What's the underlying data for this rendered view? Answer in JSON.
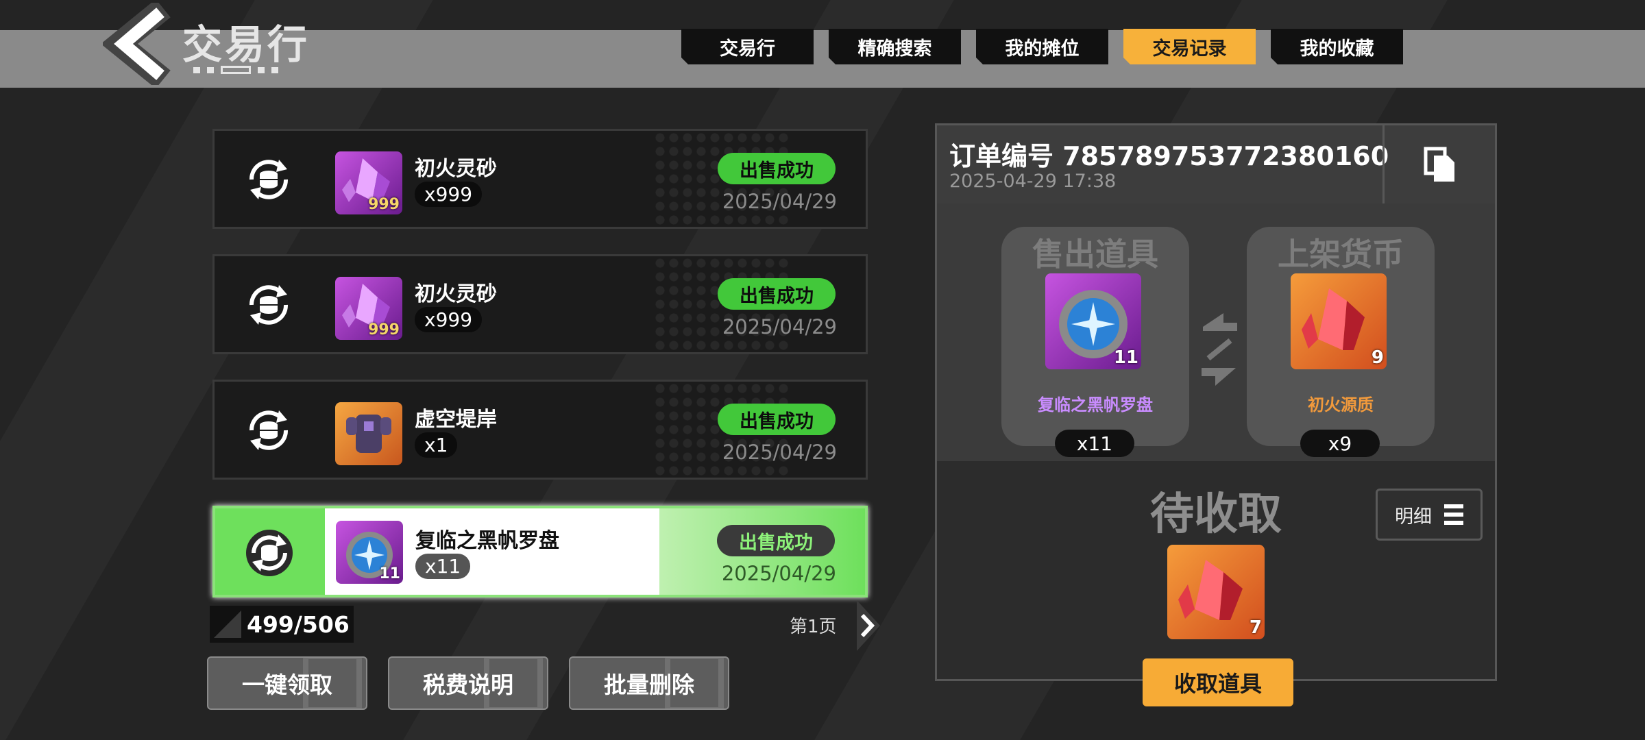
{
  "header": {
    "title": "交易行",
    "tabs": [
      {
        "label": "交易行",
        "active": false
      },
      {
        "label": "精确搜索",
        "active": false
      },
      {
        "label": "我的摊位",
        "active": false
      },
      {
        "label": "交易记录",
        "active": true
      },
      {
        "label": "我的收藏",
        "active": false
      }
    ]
  },
  "records": [
    {
      "name": "初火灵砂",
      "qty": "x999",
      "badge": "999",
      "status": "出售成功",
      "date": "2025/04/29",
      "thumb": "purple-crystal-icon",
      "selected": false
    },
    {
      "name": "初火灵砂",
      "qty": "x999",
      "badge": "999",
      "status": "出售成功",
      "date": "2025/04/29",
      "thumb": "purple-crystal-icon",
      "selected": false
    },
    {
      "name": "虚空堤岸",
      "qty": "x1",
      "badge": "",
      "status": "出售成功",
      "date": "2025/04/29",
      "thumb": "armor-icon",
      "selected": false
    },
    {
      "name": "复临之黑帆罗盘",
      "qty": "x11",
      "badge": "11",
      "status": "出售成功",
      "date": "2025/04/29",
      "thumb": "compass-icon",
      "selected": true
    }
  ],
  "list_footer": {
    "count": "499/506",
    "page": "第1页",
    "buttons": [
      "一键领取",
      "税费说明",
      "批量删除"
    ]
  },
  "order": {
    "number_label": "订单编号 785789753772380160",
    "time": "2025-04-29 17:38",
    "sold": {
      "label": "售出道具",
      "name": "复临之黑帆罗盘",
      "badge": "11",
      "qty": "x11"
    },
    "price": {
      "label": "上架货币",
      "name": "初火源质",
      "badge": "9",
      "qty": "x9"
    },
    "pending_label": "待收取",
    "detail_label": "明细",
    "pending_badge": "7",
    "collect_label": "收取道具"
  },
  "colors": {
    "tab_active": "#f7b13a",
    "status_green": "#42c83a",
    "sold_name": "#c98cff",
    "price_name": "#f29a3c",
    "collect_button": "#f7ab36"
  }
}
